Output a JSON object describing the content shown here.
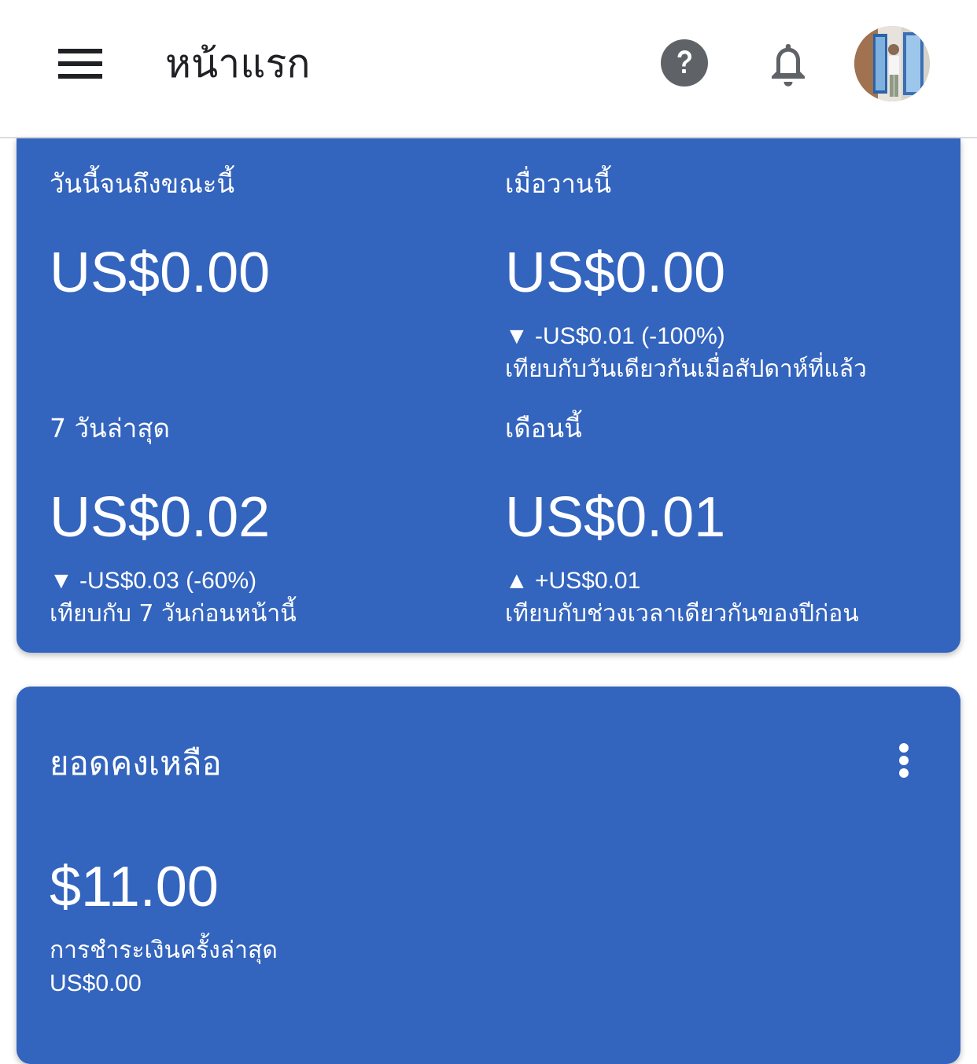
{
  "app_bar": {
    "title": "หน้าแรก",
    "menu_icon": "hamburger-menu-icon",
    "help_icon": "help-circle-icon",
    "notification_icon": "bell-icon",
    "avatar_icon": "user-avatar"
  },
  "earnings": {
    "today": {
      "label": "วันนี้จนถึงขณะนี้",
      "value": "US$0.00"
    },
    "yesterday": {
      "label": "เมื่อวานนี้",
      "value": "US$0.00",
      "change": "▼ -US$0.01 (-100%)",
      "compare": "เทียบกับวันเดียวกันเมื่อสัปดาห์ที่แล้ว"
    },
    "last7": {
      "label": "7 วันล่าสุด",
      "value": "US$0.02",
      "change": "▼ -US$0.03 (-60%)",
      "compare": "เทียบกับ 7 วันก่อนหน้านี้"
    },
    "this_month": {
      "label": "เดือนนี้",
      "value": "US$0.01",
      "change": "▲ +US$0.01",
      "compare": "เทียบกับช่วงเวลาเดียวกันของปีก่อน"
    }
  },
  "balance": {
    "title": "ยอดคงเหลือ",
    "value": "$11.00",
    "last_payment_label": "การชำระเงินครั้งล่าสุด",
    "last_payment_value": "US$0.00",
    "more_icon": "more-vertical-icon"
  },
  "colors": {
    "card_background": "#3364be",
    "app_bar_background": "#ffffff",
    "icon_dark": "#5f6368",
    "text_dark": "#202124"
  }
}
